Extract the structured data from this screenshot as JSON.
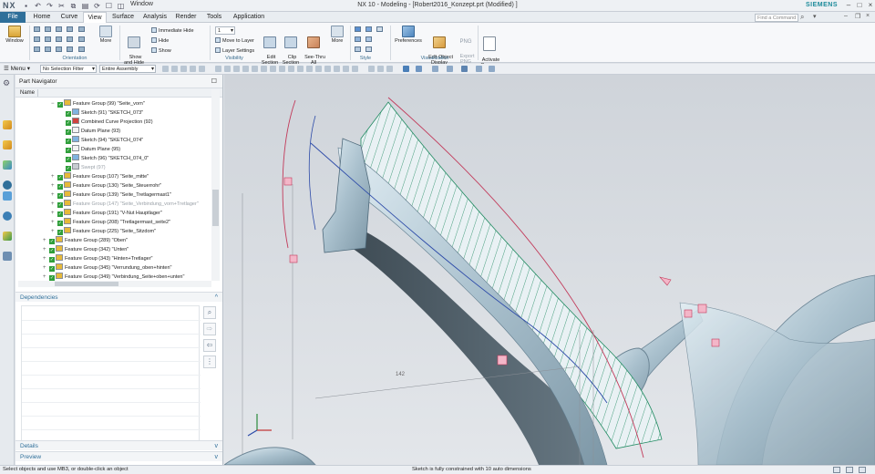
{
  "titlebar": {
    "logo": "NX",
    "window_menu": "Window",
    "title": "NX 10 - Modeling - [Robert2016_Konzept.prt (Modified) ]",
    "brand": "SIEMENS"
  },
  "tabs": [
    "File",
    "Home",
    "Curve",
    "View",
    "Surface",
    "Analysis",
    "Render",
    "Tools",
    "Application"
  ],
  "active_tab": "View",
  "search": {
    "placeholder": "Find a Command"
  },
  "ribbon": {
    "window_label": "Window",
    "more1": "More",
    "show_hide": "Show\nand Hide",
    "immediate_hide": "Immediate Hide",
    "hide": "Hide",
    "show": "Show",
    "layer_value": "1",
    "move_to_layer": "Move to Layer",
    "layer_settings": "Layer Settings",
    "edit_section": "Edit\nSection",
    "clip_section": "Clip\nSection",
    "see_thru_all": "See-Thru\nAll",
    "more2": "More",
    "preferences": "Preferences",
    "edit_object_display": "Edit Object\nDisplay",
    "export_png_icon": "PNG",
    "export_png": "Export\nPNG",
    "activate_camera": "Activate\nCamera",
    "groups": {
      "orientation": "Orientation",
      "visibility": "Visibility",
      "style": "Style",
      "visualization": "Visualization"
    }
  },
  "selection_bar": {
    "menu": "Menu",
    "filter": "No Selection Filter",
    "scope": "Entire Assembly"
  },
  "navigator": {
    "title": "Part Navigator",
    "column": "Name",
    "rows": [
      {
        "label": "Feature Group (99) \"Seite_vorn\"",
        "indent": 1,
        "exp": "−",
        "dim": false,
        "icon": "folder"
      },
      {
        "label": "Sketch (91) \"SKETCH_073\"",
        "indent": 2,
        "exp": "",
        "dim": false,
        "icon": "sketch"
      },
      {
        "label": "Combined Curve Projection (92)",
        "indent": 2,
        "exp": "",
        "dim": false,
        "icon": "curve"
      },
      {
        "label": "Datum Plane (93)",
        "indent": 2,
        "exp": "",
        "dim": false,
        "icon": "plane"
      },
      {
        "label": "Sketch (94) \"SKETCH_074\"",
        "indent": 2,
        "exp": "",
        "dim": false,
        "icon": "sketch"
      },
      {
        "label": "Datum Plane (95)",
        "indent": 2,
        "exp": "",
        "dim": false,
        "icon": "plane"
      },
      {
        "label": "Sketch (96) \"SKETCH_074_0\"",
        "indent": 2,
        "exp": "",
        "dim": false,
        "icon": "sketch"
      },
      {
        "label": "Swept (97)",
        "indent": 2,
        "exp": "",
        "dim": true,
        "icon": "swept"
      },
      {
        "label": "Feature Group (107) \"Seite_mitte\"",
        "indent": 1,
        "exp": "+",
        "dim": false,
        "icon": "folder"
      },
      {
        "label": "Feature Group (130) \"Seite_Steuerrohr\"",
        "indent": 1,
        "exp": "+",
        "dim": false,
        "icon": "folder"
      },
      {
        "label": "Feature Group (139) \"Seite_Tretlagermast1\"",
        "indent": 1,
        "exp": "+",
        "dim": false,
        "icon": "folder"
      },
      {
        "label": "Feature Group (147) \"Seite_Verbindung_vorn+Tretlager\"",
        "indent": 1,
        "exp": "+",
        "dim": true,
        "icon": "folder"
      },
      {
        "label": "Feature Group (191) \"V-Nut Hauptlager\"",
        "indent": 1,
        "exp": "+",
        "dim": false,
        "icon": "folder"
      },
      {
        "label": "Feature Group (208) \"Tretlagermast_seite2\"",
        "indent": 1,
        "exp": "+",
        "dim": false,
        "icon": "folder"
      },
      {
        "label": "Feature Group (225) \"Seite_Sitzdom\"",
        "indent": 1,
        "exp": "+",
        "dim": false,
        "icon": "folder"
      },
      {
        "label": "Feature Group (289) \"Oben\"",
        "indent": 0,
        "exp": "+",
        "dim": false,
        "icon": "folder"
      },
      {
        "label": "Feature Group (342) \"Unten\"",
        "indent": 0,
        "exp": "+",
        "dim": false,
        "icon": "folder"
      },
      {
        "label": "Feature Group (343) \"Hinten+Tretlager\"",
        "indent": 0,
        "exp": "+",
        "dim": false,
        "icon": "folder"
      },
      {
        "label": "Feature Group (345) \"Verrundung_oben+hinten\"",
        "indent": 0,
        "exp": "+",
        "dim": false,
        "icon": "folder"
      },
      {
        "label": "Feature Group (349) \"Verbindung_Seite+oben+unten\"",
        "indent": 0,
        "exp": "+",
        "dim": false,
        "icon": "folder"
      }
    ]
  },
  "panels": {
    "dependencies": "Dependencies",
    "details": "Details",
    "preview": "Preview"
  },
  "viewport": {
    "dimension_label": "142"
  },
  "status": {
    "left": "Select objects and use MB3, or double-click an object",
    "middle": "Sketch is fully constrained with 10 auto dimensions"
  },
  "colors": {
    "accent": "#2f6f9a",
    "brand": "#1b8a9a",
    "surface": "#b9ced9",
    "hatch": "#2a9a6a",
    "curve_red": "#c23a5a",
    "curve_blue": "#2c4aa8"
  }
}
